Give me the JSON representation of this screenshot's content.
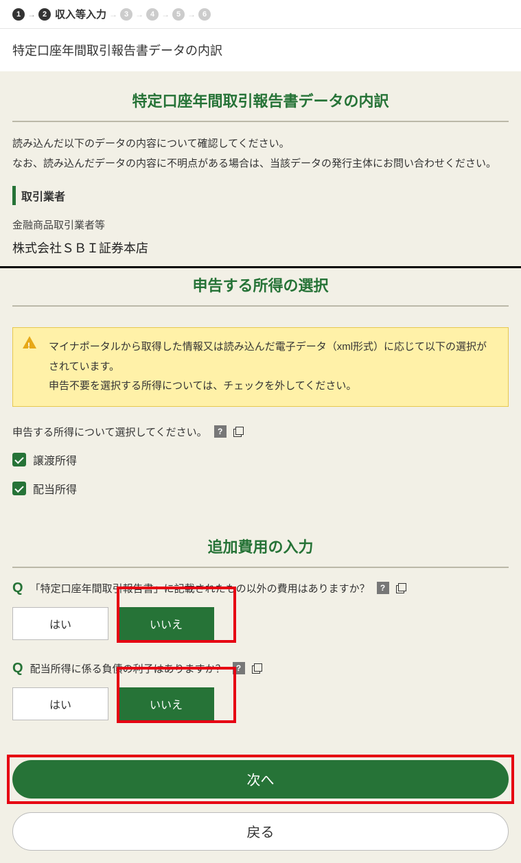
{
  "steps": {
    "n1": "1",
    "n2": "2",
    "label2": "収入等入力",
    "n3": "3",
    "n4": "4",
    "n5": "5",
    "n6": "6"
  },
  "pageTitle": "特定口座年間取引報告書データの内訳",
  "s1": {
    "heading": "特定口座年間取引報告書データの内訳",
    "intro": "読み込んだ以下のデータの内容について確認してください。\nなお、読み込んだデータの内容に不明点がある場合は、当該データの発行主体にお問い合わせください。",
    "subHeading": "取引業者",
    "fieldLabel": "金融商品取引業者等",
    "fieldValue": "株式会社ＳＢＩ証券本店"
  },
  "s2": {
    "heading": "申告する所得の選択",
    "alert": "マイナポータルから取得した情報又は読み込んだ電子データ（xml形式）に応じて以下の選択がされています。\n申告不要を選択する所得については、チェックを外してください。",
    "prompt": "申告する所得について選択してください。",
    "cb1": "譲渡所得",
    "cb2": "配当所得"
  },
  "s3": {
    "heading": "追加費用の入力",
    "q1": "「特定口座年間取引報告書」に記載されたもの以外の費用はありますか？",
    "q2": "配当所得に係る負債の利子はありますか？",
    "yes": "はい",
    "no": "いいえ"
  },
  "nav": {
    "next": "次へ",
    "back": "戻る"
  },
  "help": "?"
}
